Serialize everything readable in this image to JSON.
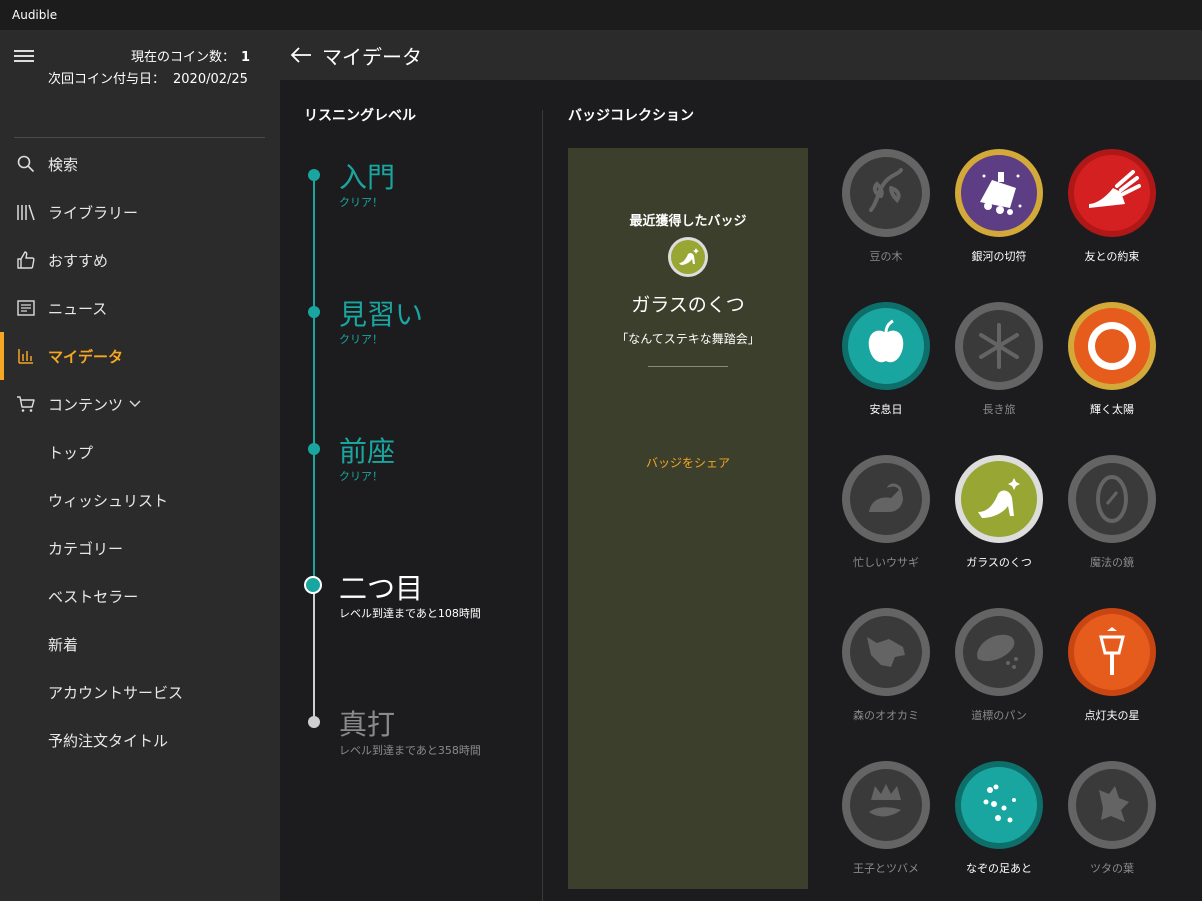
{
  "window": {
    "title": "Audible"
  },
  "sidebar": {
    "coins_label": "現在のコイン数：",
    "coins_value": "1",
    "next_coin_label": "次回コイン付与日：",
    "next_coin_date": "2020/02/25",
    "items": [
      {
        "label": "検索",
        "icon": "search-icon"
      },
      {
        "label": "ライブラリー",
        "icon": "library-icon"
      },
      {
        "label": "おすすめ",
        "icon": "thumbs-up-icon"
      },
      {
        "label": "ニュース",
        "icon": "news-icon"
      },
      {
        "label": "マイデータ",
        "icon": "bar-chart-icon",
        "active": true
      },
      {
        "label": "コンテンツ",
        "icon": "cart-icon"
      },
      {
        "label": "トップ"
      },
      {
        "label": "ウィッシュリスト"
      },
      {
        "label": "カテゴリー"
      },
      {
        "label": "ベストセラー"
      },
      {
        "label": "新着"
      },
      {
        "label": "アカウントサービス"
      },
      {
        "label": "予約注文タイトル"
      }
    ]
  },
  "header": {
    "title": "マイデータ"
  },
  "listening": {
    "title": "リスニングレベル",
    "levels": [
      {
        "name": "入門",
        "sub": "クリア！",
        "status": "cleared"
      },
      {
        "name": "見習い",
        "sub": "クリア！",
        "status": "cleared"
      },
      {
        "name": "前座",
        "sub": "クリア！",
        "status": "cleared"
      },
      {
        "name": "二つ目",
        "sub": "レベル到達まであと108時間",
        "status": "current"
      },
      {
        "name": "真打",
        "sub": "レベル到達まであと358時間",
        "status": "future"
      }
    ]
  },
  "badges": {
    "title": "バッジコレクション",
    "recent": {
      "title": "最近獲得したバッジ",
      "name": "ガラスのくつ",
      "quote": "「なんてステキな舞踏会」",
      "share": "バッジをシェア"
    },
    "items": [
      {
        "label": "豆の木",
        "earned": false,
        "icon": "beanstalk-icon"
      },
      {
        "label": "銀河の切符",
        "earned": true,
        "icon": "galaxy-train-icon"
      },
      {
        "label": "友との約束",
        "earned": true,
        "icon": "winged-shoe-icon"
      },
      {
        "label": "安息日",
        "earned": true,
        "icon": "apple-icon"
      },
      {
        "label": "長き旅",
        "earned": false,
        "icon": "snowflake-icon"
      },
      {
        "label": "輝く太陽",
        "earned": true,
        "icon": "sun-icon"
      },
      {
        "label": "忙しいウサギ",
        "earned": false,
        "icon": "rabbit-icon"
      },
      {
        "label": "ガラスのくつ",
        "earned": true,
        "icon": "glass-slipper-icon"
      },
      {
        "label": "魔法の鏡",
        "earned": false,
        "icon": "mirror-icon"
      },
      {
        "label": "森のオオカミ",
        "earned": false,
        "icon": "wolf-icon"
      },
      {
        "label": "道標のパン",
        "earned": false,
        "icon": "bread-icon"
      },
      {
        "label": "点灯夫の星",
        "earned": true,
        "icon": "street-lamp-icon"
      },
      {
        "label": "王子とツバメ",
        "earned": false,
        "icon": "crown-bird-icon"
      },
      {
        "label": "なぞの足あと",
        "earned": true,
        "icon": "footprints-icon"
      },
      {
        "label": "ツタの葉",
        "earned": false,
        "icon": "ivy-leaf-icon"
      }
    ]
  },
  "colors": {
    "accent": "#f5a623",
    "teal": "#1aa6a0",
    "sidebar_bg": "#2b2b2b",
    "content_bg": "#1c1c1e",
    "recent_panel_bg": "#3c3f2c"
  }
}
